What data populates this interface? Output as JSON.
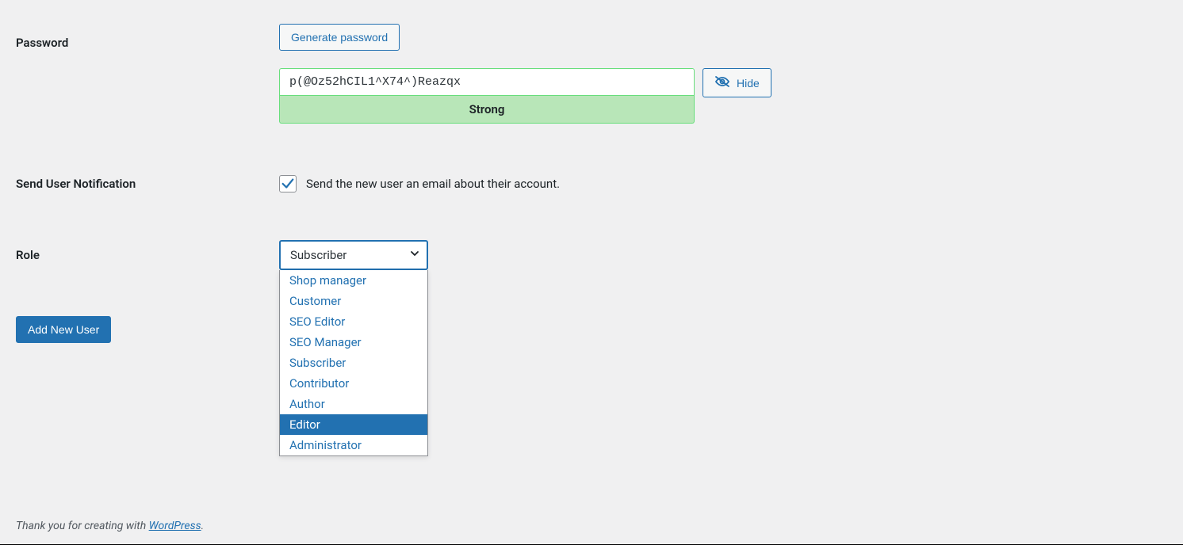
{
  "password": {
    "label": "Password",
    "generate_button": "Generate password",
    "value": "p(@Oz52hCIL1^X74^)Reazqx",
    "strength": "Strong",
    "hide_button": "Hide"
  },
  "notification": {
    "label": "Send User Notification",
    "checked": true,
    "description": "Send the new user an email about their account."
  },
  "role": {
    "label": "Role",
    "selected": "Subscriber",
    "options": [
      "Shop manager",
      "Customer",
      "SEO Editor",
      "SEO Manager",
      "Subscriber",
      "Contributor",
      "Author",
      "Editor",
      "Administrator"
    ],
    "highlighted_index": 7
  },
  "submit": {
    "button": "Add New User"
  },
  "footer": {
    "prefix": "Thank you for creating with ",
    "link_text": "WordPress",
    "suffix": "."
  }
}
